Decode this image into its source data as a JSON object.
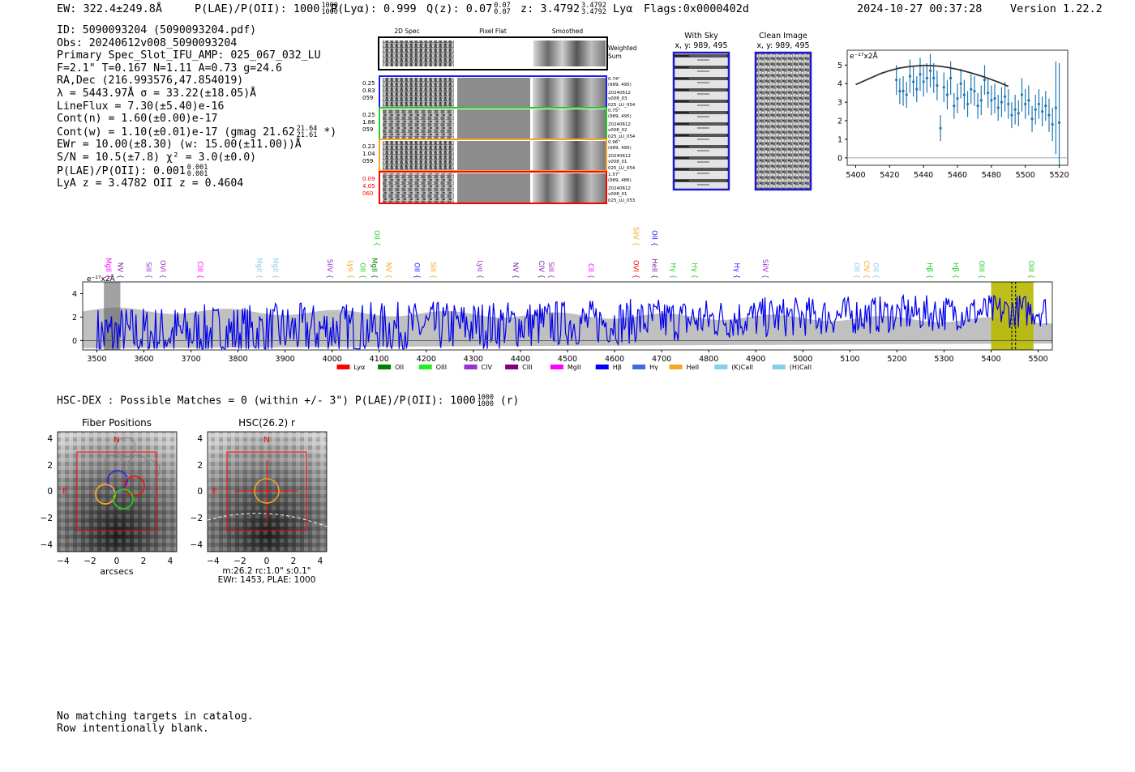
{
  "header": {
    "ew": "EW: 322.4±249.8Å",
    "plae_label": "P(LAE)/P(OII): 1000",
    "plae_hi": "1000",
    "plae_lo": "1000",
    "plya": "P(Lyα): 0.999",
    "qz_label": "Q(z): 0.07",
    "qz_hi": "0.07",
    "qz_lo": "0.07",
    "z_label": "z: 3.4792",
    "z_hi": "3.4792",
    "z_lo": "3.4792",
    "z_line": "Lyα",
    "flags": "Flags:0x0000402d",
    "timestamp": "2024-10-27 00:37:28",
    "version": "Version 1.22.2"
  },
  "info": {
    "id": "ID: 5090093204 (5090093204.pdf)",
    "obs": "Obs: 20240612v008_5090093204",
    "primary": "Primary Spec_Slot_IFU_AMP: 025_067_032_LU",
    "params": "F=2.1\"  T=0.167  N=1.11  A=0.73  g=24.6",
    "radec": "RA,Dec (216.993576,47.854019)",
    "lambda": "λ = 5443.97Å   σ = 33.22(±18.05)Å",
    "lineflux": "LineFlux = 7.30(±5.40)e-16",
    "contn": "Cont(n) = 1.60(±0.00)e-17",
    "contw_a": "Cont(w) = 1.10(±0.01)e-17 (gmag 21.62",
    "contw_hi": "21.64",
    "contw_lo": "21.61",
    "contw_b": "*)",
    "ewr": "EWr = 10.00(±8.30) (w: 15.00(±11.00))Å",
    "sn": "S/N = 10.5(±7.8)  χ² = 3.0(±0.0)",
    "plae2": "P(LAE)/P(OII): 0.001",
    "plae2_hi": "0.001",
    "plae2_lo": "0.001",
    "z": "LyA z = 3.4782  OII z = 0.4604"
  },
  "cutouts": {
    "col_labels": [
      "2D Spec",
      "Pixel Flat",
      "Smoothed"
    ],
    "weighted_sum": [
      "Weighted",
      "Sum"
    ],
    "rows": [
      {
        "left": [
          "0.25",
          "0.83",
          "059"
        ],
        "left_color": "#000000",
        "border": "#1a1aff",
        "right": [
          "0.74\"",
          "(989, 495)",
          "20240612",
          "v008_03",
          "025_LU_054"
        ]
      },
      {
        "left": [
          "0.25",
          "1.86",
          "059"
        ],
        "left_color": "#000000",
        "border": "#22cc22",
        "right": [
          "0.75\"",
          "(989, 495)",
          "20240612",
          "v008_02",
          "025_LU_054"
        ]
      },
      {
        "left": [
          "0.23",
          "1.04",
          "059"
        ],
        "left_color": "#000000",
        "border": "#f5a623",
        "right": [
          "0.96\"",
          "(989, 495)",
          "20240612",
          "v008_01",
          "025_LU_054"
        ]
      },
      {
        "left": [
          "0.09",
          "4.05",
          "060"
        ],
        "left_color": "#ff0000",
        "border": "#ff0000",
        "right": [
          "1.57\"",
          "(989, 486)",
          "20240612",
          "v008_01",
          "025_LU_053"
        ]
      }
    ]
  },
  "with_sky": {
    "title": "With Sky",
    "coords": "x, y: 989, 495"
  },
  "clean_image": {
    "title": "Clean Image",
    "coords": "x, y: 989, 495"
  },
  "bottom": {
    "hsc_line": "HSC-DEX : Possible Matches = 0 (within +/- 3\")  P(LAE)/P(OII): 1000",
    "hsc_hi": "1000",
    "hsc_lo": "1000",
    "hsc_tail": "(r)",
    "fiber_title": "Fiber Positions",
    "fiber_xlabel": "arcsecs",
    "hsc_title": "HSC(26.2) r",
    "hsc_caption1": "m:26.2 rc:1.0\"  s:0.1\"",
    "hsc_caption2": "EWr: 1453, PLAE: 1000",
    "north": "N",
    "east": "E",
    "notes": [
      "No matching targets in catalog.",
      "Row intentionally blank."
    ]
  },
  "chart_data": [
    {
      "type": "scatter",
      "name": "line_fit",
      "ylabel_unit": "e⁻¹⁷x2Å",
      "xlim": [
        5395,
        5525
      ],
      "ylim": [
        -0.4,
        5.8
      ],
      "xticks": [
        5400,
        5420,
        5440,
        5460,
        5480,
        5500,
        5520
      ],
      "yticks": [
        0,
        1,
        2,
        3,
        4,
        5
      ],
      "color_points": "#1f77b4",
      "color_fit": "#333333",
      "points": {
        "x": [
          5424,
          5426,
          5428,
          5430,
          5432,
          5434,
          5436,
          5438,
          5440,
          5442,
          5444,
          5446,
          5448,
          5450,
          5452,
          5454,
          5456,
          5458,
          5460,
          5462,
          5464,
          5466,
          5468,
          5470,
          5472,
          5474,
          5476,
          5478,
          5480,
          5482,
          5484,
          5486,
          5488,
          5490,
          5492,
          5494,
          5496,
          5498,
          5500,
          5502,
          5504,
          5506,
          5508,
          5510,
          5512,
          5514,
          5516,
          5518,
          5520
        ],
        "y": [
          4.2,
          3.6,
          3.6,
          3.4,
          4.4,
          4.1,
          3.7,
          4.5,
          4.1,
          4.3,
          4.7,
          4.3,
          3.9,
          1.6,
          3.8,
          3.4,
          4.3,
          2.8,
          3.2,
          4.0,
          3.4,
          2.9,
          3.7,
          3.6,
          2.8,
          3.1,
          4.2,
          3.5,
          3.1,
          3.2,
          2.7,
          3.0,
          3.3,
          2.9,
          2.3,
          2.6,
          2.4,
          3.4,
          2.9,
          3.1,
          2.1,
          2.6,
          2.9,
          2.5,
          2.8,
          2.3,
          1.8,
          2.7,
          1.9,
          2.3,
          2.3,
          2.2,
          2.3
        ],
        "yerr": [
          0.8,
          0.7,
          0.8,
          0.7,
          0.9,
          0.8,
          0.7,
          0.9,
          0.8,
          0.8,
          0.9,
          0.8,
          0.8,
          0.7,
          0.8,
          0.8,
          0.9,
          0.7,
          0.8,
          0.8,
          0.8,
          0.7,
          0.8,
          0.8,
          0.7,
          0.8,
          0.8,
          0.8,
          0.8,
          0.8,
          0.7,
          0.8,
          0.8,
          0.8,
          0.7,
          0.8,
          0.7,
          0.9,
          0.8,
          0.8,
          0.7,
          0.8,
          0.8,
          0.8,
          0.8,
          0.9,
          0.9,
          2.5,
          3.2
        ]
      },
      "fit": {
        "x": [
          5400,
          5405,
          5410,
          5415,
          5420,
          5425,
          5430,
          5435,
          5440,
          5445,
          5450,
          5455,
          5460,
          5465,
          5470,
          5475,
          5480,
          5485,
          5490
        ],
        "y": [
          3.95,
          4.15,
          4.35,
          4.55,
          4.7,
          4.82,
          4.9,
          4.95,
          4.98,
          4.97,
          4.93,
          4.86,
          4.77,
          4.65,
          4.52,
          4.38,
          4.22,
          4.05,
          3.85
        ]
      }
    },
    {
      "type": "line",
      "name": "full_spectrum",
      "ylabel_unit": "e⁻¹⁷x2Å",
      "xlim": [
        3470,
        5530
      ],
      "ylim": [
        -0.8,
        5.0
      ],
      "xticks": [
        3500,
        3600,
        3700,
        3800,
        3900,
        4000,
        4100,
        4200,
        4300,
        4400,
        4500,
        4600,
        4700,
        4800,
        4900,
        5000,
        5100,
        5200,
        5300,
        5400,
        5500
      ],
      "yticks": [
        0,
        2,
        4
      ],
      "colors": {
        "spectrum": "#0000ee",
        "error_band": "#c0c0c0",
        "highlight": "#b8b800"
      },
      "highlight_range": [
        5400,
        5490
      ],
      "emission_lines": [
        {
          "label": "MgII",
          "x": 3520,
          "color": "#ff00ff",
          "tier": 2
        },
        {
          "label": "NV",
          "x": 3545,
          "color": "#7a1fa2",
          "tier": 2
        },
        {
          "label": "SiII",
          "x": 3605,
          "color": "#9932cc",
          "tier": 2
        },
        {
          "label": "OVI",
          "x": 3635,
          "color": "#9932cc",
          "tier": 2
        },
        {
          "label": "CIII",
          "x": 3715,
          "color": "#ff00ff",
          "tier": 2
        },
        {
          "label": "MgII",
          "x": 3840,
          "color": "#87ceeb",
          "tier": 2
        },
        {
          "label": "MgII",
          "x": 3875,
          "color": "#87ceeb",
          "tier": 2
        },
        {
          "label": "SiIV",
          "x": 3990,
          "color": "#9932cc",
          "tier": 2
        },
        {
          "label": "Lyα",
          "x": 4035,
          "color": "#f5a623",
          "tier": 2
        },
        {
          "label": "OII",
          "x": 4060,
          "color": "#22cc22",
          "tier": 2
        },
        {
          "label": "OII",
          "x": 4090,
          "color": "#22cc22",
          "tier": 1
        },
        {
          "label": "MgII",
          "x": 4085,
          "color": "#008000",
          "tier": 2
        },
        {
          "label": "NV",
          "x": 4115,
          "color": "#f5a623",
          "tier": 2
        },
        {
          "label": "OII",
          "x": 4175,
          "color": "#1a1aff",
          "tier": 2
        },
        {
          "label": "SiII",
          "x": 4210,
          "color": "#f5a623",
          "tier": 2
        },
        {
          "label": "Lyα",
          "x": 4310,
          "color": "#9932cc",
          "tier": 2
        },
        {
          "label": "NV",
          "x": 4385,
          "color": "#7a1fa2",
          "tier": 2
        },
        {
          "label": "CIV",
          "x": 4440,
          "color": "#7a1fa2",
          "tier": 2
        },
        {
          "label": "SiII",
          "x": 4460,
          "color": "#9932cc",
          "tier": 2
        },
        {
          "label": "CII",
          "x": 4545,
          "color": "#ff00ff",
          "tier": 2
        },
        {
          "label": "SiIV",
          "x": 4640,
          "color": "#f5a623",
          "tier": 1
        },
        {
          "label": "OVI",
          "x": 4640,
          "color": "#ff0000",
          "tier": 2
        },
        {
          "label": "OII",
          "x": 4680,
          "color": "#1a1aff",
          "tier": 1
        },
        {
          "label": "HeII",
          "x": 4680,
          "color": "#7a1fa2",
          "tier": 2
        },
        {
          "label": "Hγ",
          "x": 4720,
          "color": "#22cc22",
          "tier": 2
        },
        {
          "label": "Hγ",
          "x": 4765,
          "color": "#22cc22",
          "tier": 2
        },
        {
          "label": "Hγ",
          "x": 4855,
          "color": "#1a1aff",
          "tier": 2
        },
        {
          "label": "SiIV",
          "x": 4915,
          "color": "#9932cc",
          "tier": 2
        },
        {
          "label": "OII",
          "x": 5110,
          "color": "#87ceeb",
          "tier": 2
        },
        {
          "label": "CIV",
          "x": 5130,
          "color": "#f5a623",
          "tier": 2
        },
        {
          "label": "OII",
          "x": 5150,
          "color": "#87ceeb",
          "tier": 2
        },
        {
          "label": "Hβ",
          "x": 5265,
          "color": "#22cc22",
          "tier": 2
        },
        {
          "label": "Hβ",
          "x": 5320,
          "color": "#22cc22",
          "tier": 2
        },
        {
          "label": "OIII",
          "x": 5375,
          "color": "#22cc22",
          "tier": 2
        },
        {
          "label": "OIII",
          "x": 5480,
          "color": "#22cc22",
          "tier": 2
        }
      ],
      "legend": [
        {
          "label": "Lyα",
          "color": "#ff0000"
        },
        {
          "label": "OII",
          "color": "#008000"
        },
        {
          "label": "OIII",
          "color": "#22ee22"
        },
        {
          "label": "CIV",
          "color": "#9932cc"
        },
        {
          "label": "CIII",
          "color": "#800080"
        },
        {
          "label": "MgII",
          "color": "#ff00ff"
        },
        {
          "label": "Hβ",
          "color": "#0000ff"
        },
        {
          "label": "Hγ",
          "color": "#4169e1"
        },
        {
          "label": "HeII",
          "color": "#f5a623"
        },
        {
          "label": "(K)CaII",
          "color": "#87ceeb"
        },
        {
          "label": "(H)CaII",
          "color": "#87ceeb"
        }
      ]
    }
  ]
}
